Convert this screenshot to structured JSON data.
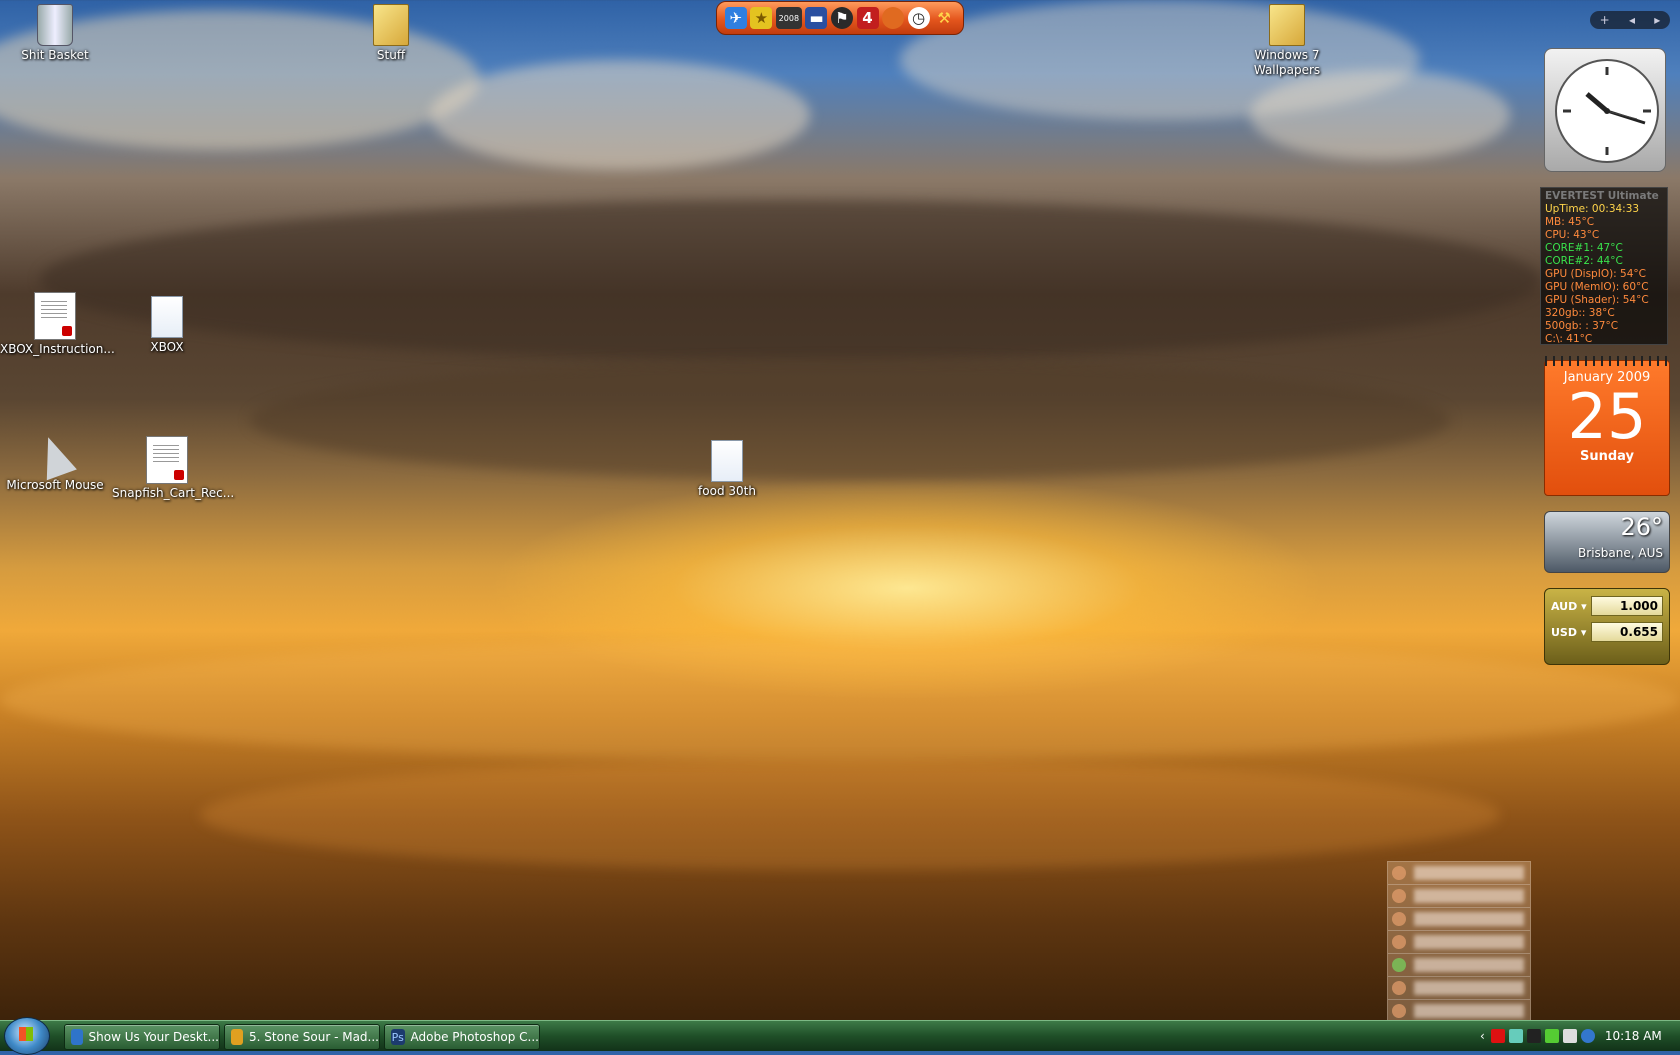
{
  "desktop_icons": [
    {
      "label": "Shit Basket",
      "icon": "recycle-bin-icon"
    },
    {
      "label": "Stuff",
      "icon": "folder-icon"
    },
    {
      "label": "Windows 7 Wallpapers",
      "icon": "folder-icon"
    },
    {
      "label": "XBOX_Instruction...",
      "icon": "pdf-file-icon"
    },
    {
      "label": "XBOX",
      "icon": "text-file-icon"
    },
    {
      "label": "Microsoft Mouse",
      "icon": "mouse-shortcut-icon"
    },
    {
      "label": "Snapfish_Cart_Rec...",
      "icon": "pdf-file-icon"
    },
    {
      "label": "food 30th",
      "icon": "text-file-icon"
    }
  ],
  "launchbar": {
    "icons": [
      "plane-icon",
      "star-icon",
      "2008-icon",
      "train-icon",
      "running-man-icon",
      "four-icon",
      "orange-bubble-icon",
      "clock-icon",
      "hammer-icon"
    ],
    "year_text": "2008",
    "four_text": "4"
  },
  "sidebar": {
    "controls": [
      "+",
      "◂",
      "▸"
    ],
    "everest": {
      "title": "EVERTEST Ultimate",
      "lines": [
        {
          "text": "UpTime: 00:34:33",
          "color": "#ffd54a"
        },
        {
          "text": "MB: 45°C",
          "color": "#ff8a3d"
        },
        {
          "text": "CPU: 43°C",
          "color": "#ff8a3d"
        },
        {
          "text": "CORE#1: 47°C",
          "color": "#39e34c"
        },
        {
          "text": "CORE#2: 44°C",
          "color": "#39e34c"
        },
        {
          "text": "GPU (DispIO): 54°C",
          "color": "#ff8a3d"
        },
        {
          "text": "GPU (MemIO): 60°C",
          "color": "#ff8a3d"
        },
        {
          "text": "GPU (Shader): 54°C",
          "color": "#ff8a3d"
        },
        {
          "text": "320gb:: 38°C",
          "color": "#ff8a3d"
        },
        {
          "text": "500gb: : 37°C",
          "color": "#ff8a3d"
        },
        {
          "text": "C:\\: 41°C",
          "color": "#ff8a3d"
        }
      ]
    },
    "calendar": {
      "month": "January 2009",
      "day": "25",
      "weekday": "Sunday"
    },
    "weather": {
      "temp": "26°",
      "city": "Brisbane, AUS"
    },
    "currency": {
      "from_code": "AUD ▾",
      "from_value": "1.000",
      "to_code": "USD ▾",
      "to_value": "0.655"
    }
  },
  "taskbar": {
    "buttons": [
      {
        "label": "Show Us Your Deskt...",
        "icon": "ie-icon"
      },
      {
        "label": "5. Stone Sour - Mad...",
        "icon": "winamp-icon"
      },
      {
        "label": "Adobe Photoshop C...",
        "icon": "photoshop-icon",
        "icon_text": "Ps"
      }
    ],
    "tray_chevron": "‹",
    "clock": "10:18 AM"
  },
  "colors": {
    "everest_title": "#7a7a7a",
    "cal_orange": "#ff7a2b"
  }
}
